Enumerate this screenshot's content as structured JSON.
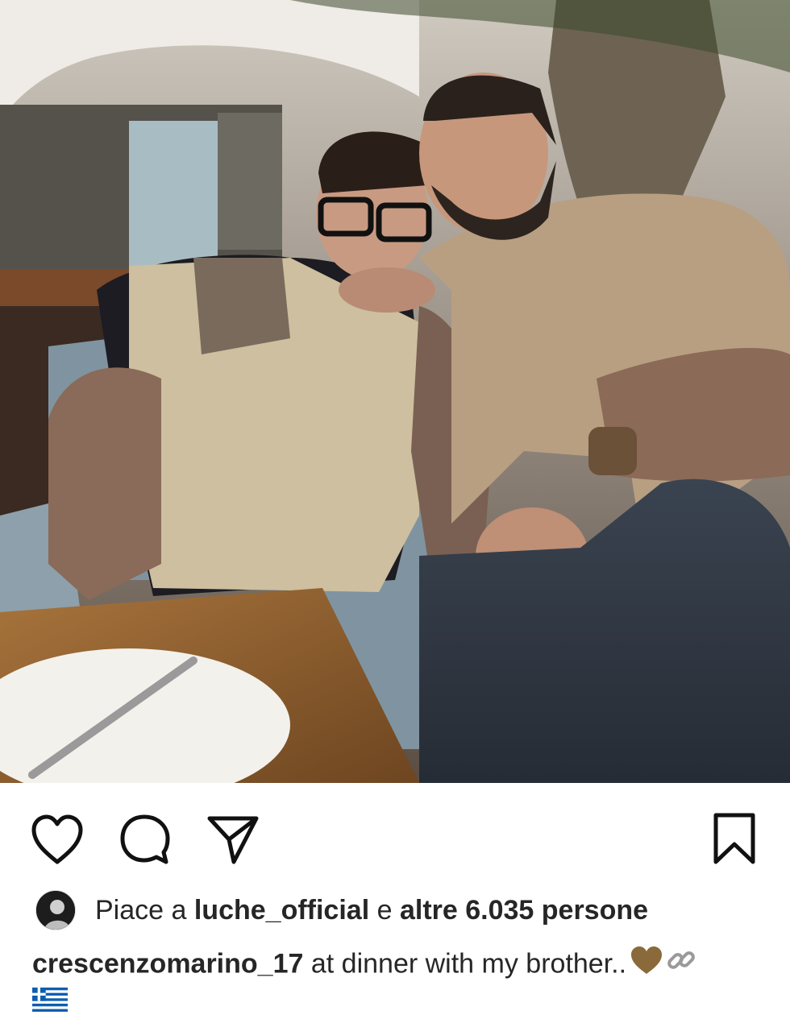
{
  "post": {
    "photo_alt": "Two men sitting at a restaurant table",
    "likes": {
      "prefix": "Piace a",
      "user": "luche_official",
      "joiner": "e",
      "others": "altre 6.035 persone"
    },
    "caption": {
      "username": "crescenzomarino_17",
      "text": "at dinner with my brother..",
      "emojis": [
        "brown-heart",
        "link",
        "greece-flag"
      ]
    }
  },
  "actions": {
    "like_icon": "heart-icon",
    "comment_icon": "comment-icon",
    "share_icon": "share-icon",
    "save_icon": "bookmark-icon"
  },
  "colors": {
    "text": "#262626",
    "background": "#ffffff",
    "brown_heart": "#8a6a3a"
  }
}
